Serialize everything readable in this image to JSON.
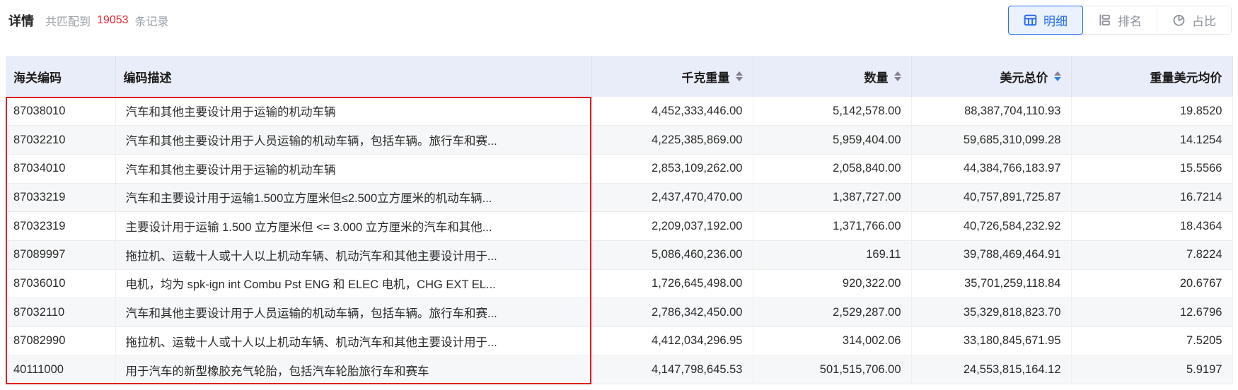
{
  "header": {
    "title": "详情",
    "match": {
      "prefix": "共匹配到",
      "count": "19053",
      "suffix": "条记录"
    },
    "views": [
      {
        "label": "明细",
        "icon": "table-icon",
        "active": true
      },
      {
        "label": "排名",
        "icon": "ranking-icon",
        "active": false
      },
      {
        "label": "占比",
        "icon": "pie-icon",
        "active": false
      }
    ]
  },
  "table": {
    "columns": [
      {
        "label": "海关编码",
        "sortable": false
      },
      {
        "label": "编码描述",
        "sortable": false
      },
      {
        "label": "千克重量",
        "sortable": true,
        "sort": "none"
      },
      {
        "label": "数量",
        "sortable": true,
        "sort": "none"
      },
      {
        "label": "美元总价",
        "sortable": true,
        "sort": "desc"
      },
      {
        "label": "重量美元均价",
        "sortable": false
      }
    ],
    "rows": [
      {
        "code": "87038010",
        "desc": "汽车和其他主要设计用于运输的机动车辆",
        "weight": "4,452,333,446.00",
        "qty": "5,142,578.00",
        "total": "88,387,704,110.93",
        "avg": "19.8520"
      },
      {
        "code": "87032210",
        "desc": "汽车和其他主要设计用于人员运输的机动车辆，包括车辆。旅行车和赛...",
        "weight": "4,225,385,869.00",
        "qty": "5,959,404.00",
        "total": "59,685,310,099.28",
        "avg": "14.1254"
      },
      {
        "code": "87034010",
        "desc": "汽车和其他主要设计用于运输的机动车辆",
        "weight": "2,853,109,262.00",
        "qty": "2,058,840.00",
        "total": "44,384,766,183.97",
        "avg": "15.5566"
      },
      {
        "code": "87033219",
        "desc": "汽车和主要设计用于运输1.500立方厘米但≤2.500立方厘米的机动车辆...",
        "weight": "2,437,470,470.00",
        "qty": "1,387,727.00",
        "total": "40,757,891,725.87",
        "avg": "16.7214"
      },
      {
        "code": "87032319",
        "desc": "主要设计用于运输 1.500 立方厘米但 <= 3.000 立方厘米的汽车和其他...",
        "weight": "2,209,037,192.00",
        "qty": "1,371,766.00",
        "total": "40,726,584,232.92",
        "avg": "18.4364"
      },
      {
        "code": "87089997",
        "desc": "拖拉机、运载十人或十人以上机动车辆、机动汽车和其他主要设计用于...",
        "weight": "5,086,460,236.00",
        "qty": "169.11",
        "total": "39,788,469,464.91",
        "avg": "7.8224"
      },
      {
        "code": "87036010",
        "desc": "电机，均为 spk-ign int Combu Pst ENG 和 ELEC 电机，CHG EXT EL...",
        "weight": "1,726,645,498.00",
        "qty": "920,322.00",
        "total": "35,701,259,118.84",
        "avg": "20.6767"
      },
      {
        "code": "87032110",
        "desc": "汽车和其他主要设计用于人员运输的机动车辆，包括车辆。旅行车和赛...",
        "weight": "2,786,342,450.00",
        "qty": "2,529,287.00",
        "total": "35,329,818,823.70",
        "avg": "12.6796"
      },
      {
        "code": "87082990",
        "desc": "拖拉机、运载十人或十人以上机动车辆、机动汽车和其他主要设计用于...",
        "weight": "4,412,034,296.95",
        "qty": "314,002.06",
        "total": "33,180,845,671.95",
        "avg": "7.5205"
      },
      {
        "code": "40111000",
        "desc": "用于汽车的新型橡胶充气轮胎，包括汽车轮胎旅行车和赛车",
        "weight": "4,147,798,645.53",
        "qty": "501,515,706.00",
        "total": "24,553,815,164.12",
        "avg": "5.9197"
      }
    ]
  },
  "colors": {
    "accent_blue": "#2468f2",
    "count_red": "#f5222d",
    "highlight_border": "#e01e1e",
    "header_bg": "#e9edf9",
    "active_btn_bg": "#eaf2fe"
  }
}
